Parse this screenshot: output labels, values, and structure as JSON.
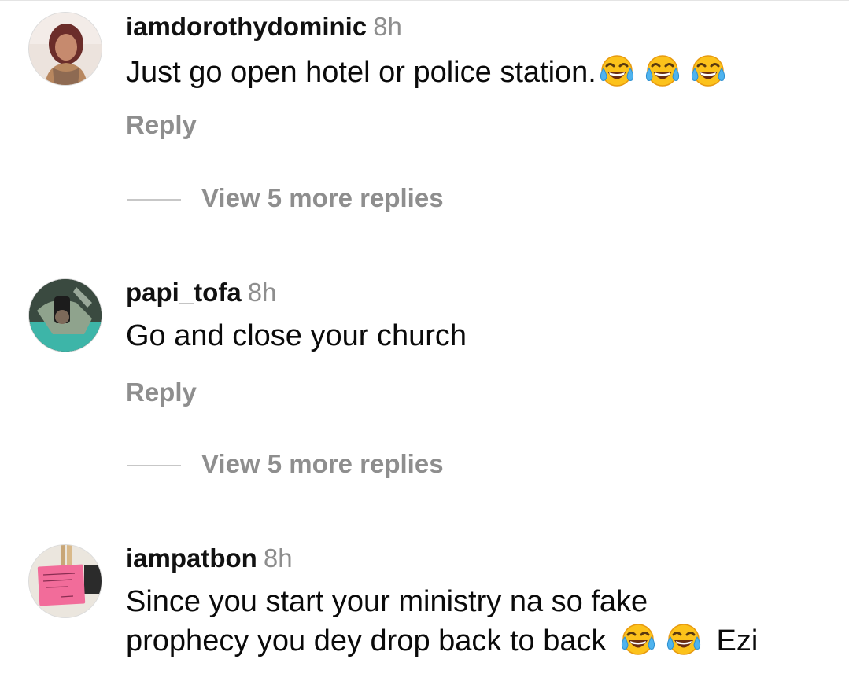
{
  "colors": {
    "username": "#111111",
    "secondary_text": "#8e8e8e",
    "divider": "#c7c7c7"
  },
  "icons": {
    "emoji": "face-with-tears-of-joy-icon"
  },
  "comments": [
    {
      "username": "iamdorothydominic",
      "time": "8h",
      "text": "Just go open hotel or police station.",
      "reply_label": "Reply",
      "more_replies_label": "View 5 more replies"
    },
    {
      "username": "papi_tofa",
      "time": "8h",
      "text": "Go and close your church",
      "reply_label": "Reply",
      "more_replies_label": "View 5 more replies"
    },
    {
      "username": "iampatbon",
      "time": "8h",
      "text_line1": "Since you start your ministry na so fake",
      "text_line2": "prophecy you dey drop back to back",
      "text_line2_suffix": "Ezi"
    }
  ]
}
